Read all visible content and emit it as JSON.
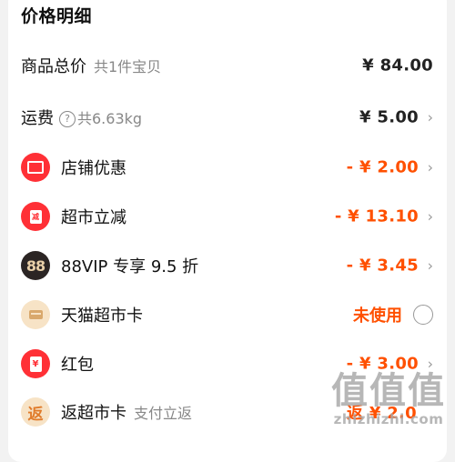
{
  "header": {
    "title": "价格明细"
  },
  "rows": [
    {
      "label": "商品总价",
      "sub": "共1件宝贝",
      "amount": "¥ 84.00"
    },
    {
      "label": "运费",
      "help_icon": "question-circle-icon",
      "sub": "共6.63kg",
      "amount": "¥ 5.00",
      "chevron": "›"
    },
    {
      "label": "店铺优惠",
      "icon": "ticket-icon",
      "amount": "- ¥ 2.00",
      "chevron": "›"
    },
    {
      "label": "超市立减",
      "icon": "shopping-bag-icon",
      "icon_text": "减",
      "amount": "- ¥ 13.10",
      "chevron": "›"
    },
    {
      "label": "88VIP 专享 9.5 折",
      "icon": "88vip-icon",
      "icon_text": "88",
      "amount": "- ¥ 3.45",
      "chevron": "›"
    },
    {
      "label": "天猫超市卡",
      "icon": "card-icon",
      "status": "未使用"
    },
    {
      "label": "红包",
      "icon": "red-packet-icon",
      "icon_text": "¥",
      "amount": "- ¥ 3.00",
      "chevron": "›"
    },
    {
      "label": "返超市卡",
      "icon": "rebate-icon",
      "icon_text": "返",
      "sub": "支付立返",
      "amount": "返 ¥ 2.0"
    }
  ],
  "watermark": {
    "top": "值值值",
    "bottom": "zhizhizhi.com"
  },
  "colors": {
    "accent": "#ff5000",
    "icon_red": "#ff3036",
    "icon_dark": "#2b2524",
    "icon_beige": "#f7e3c6"
  }
}
